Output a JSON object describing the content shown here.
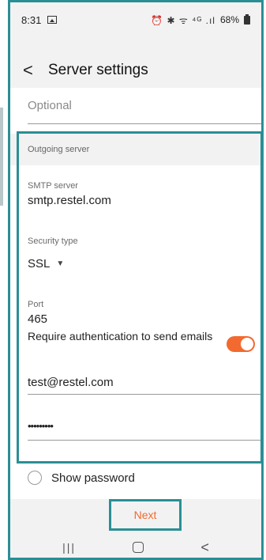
{
  "status_bar": {
    "time": "8:31",
    "icons": "⏰ ✱ ᯤ ⁴ᴳ .ıl",
    "battery": "68%"
  },
  "header": {
    "title": "Server settings"
  },
  "incoming": {
    "optional_placeholder": "Optional"
  },
  "outgoing": {
    "section_title": "Outgoing server",
    "smtp_label": "SMTP server",
    "smtp_value": "smtp.restel.com",
    "security_label": "Security type",
    "security_value": "SSL",
    "port_label": "Port",
    "port_value": "465",
    "auth_label": "Require authentication to send emails",
    "auth_enabled": true,
    "username_value": "test@restel.com",
    "password_value": "•••••••••"
  },
  "show_password_label": "Show password",
  "next_label": "Next",
  "colors": {
    "accent": "#f26a2f",
    "highlight": "#2a8f95"
  }
}
